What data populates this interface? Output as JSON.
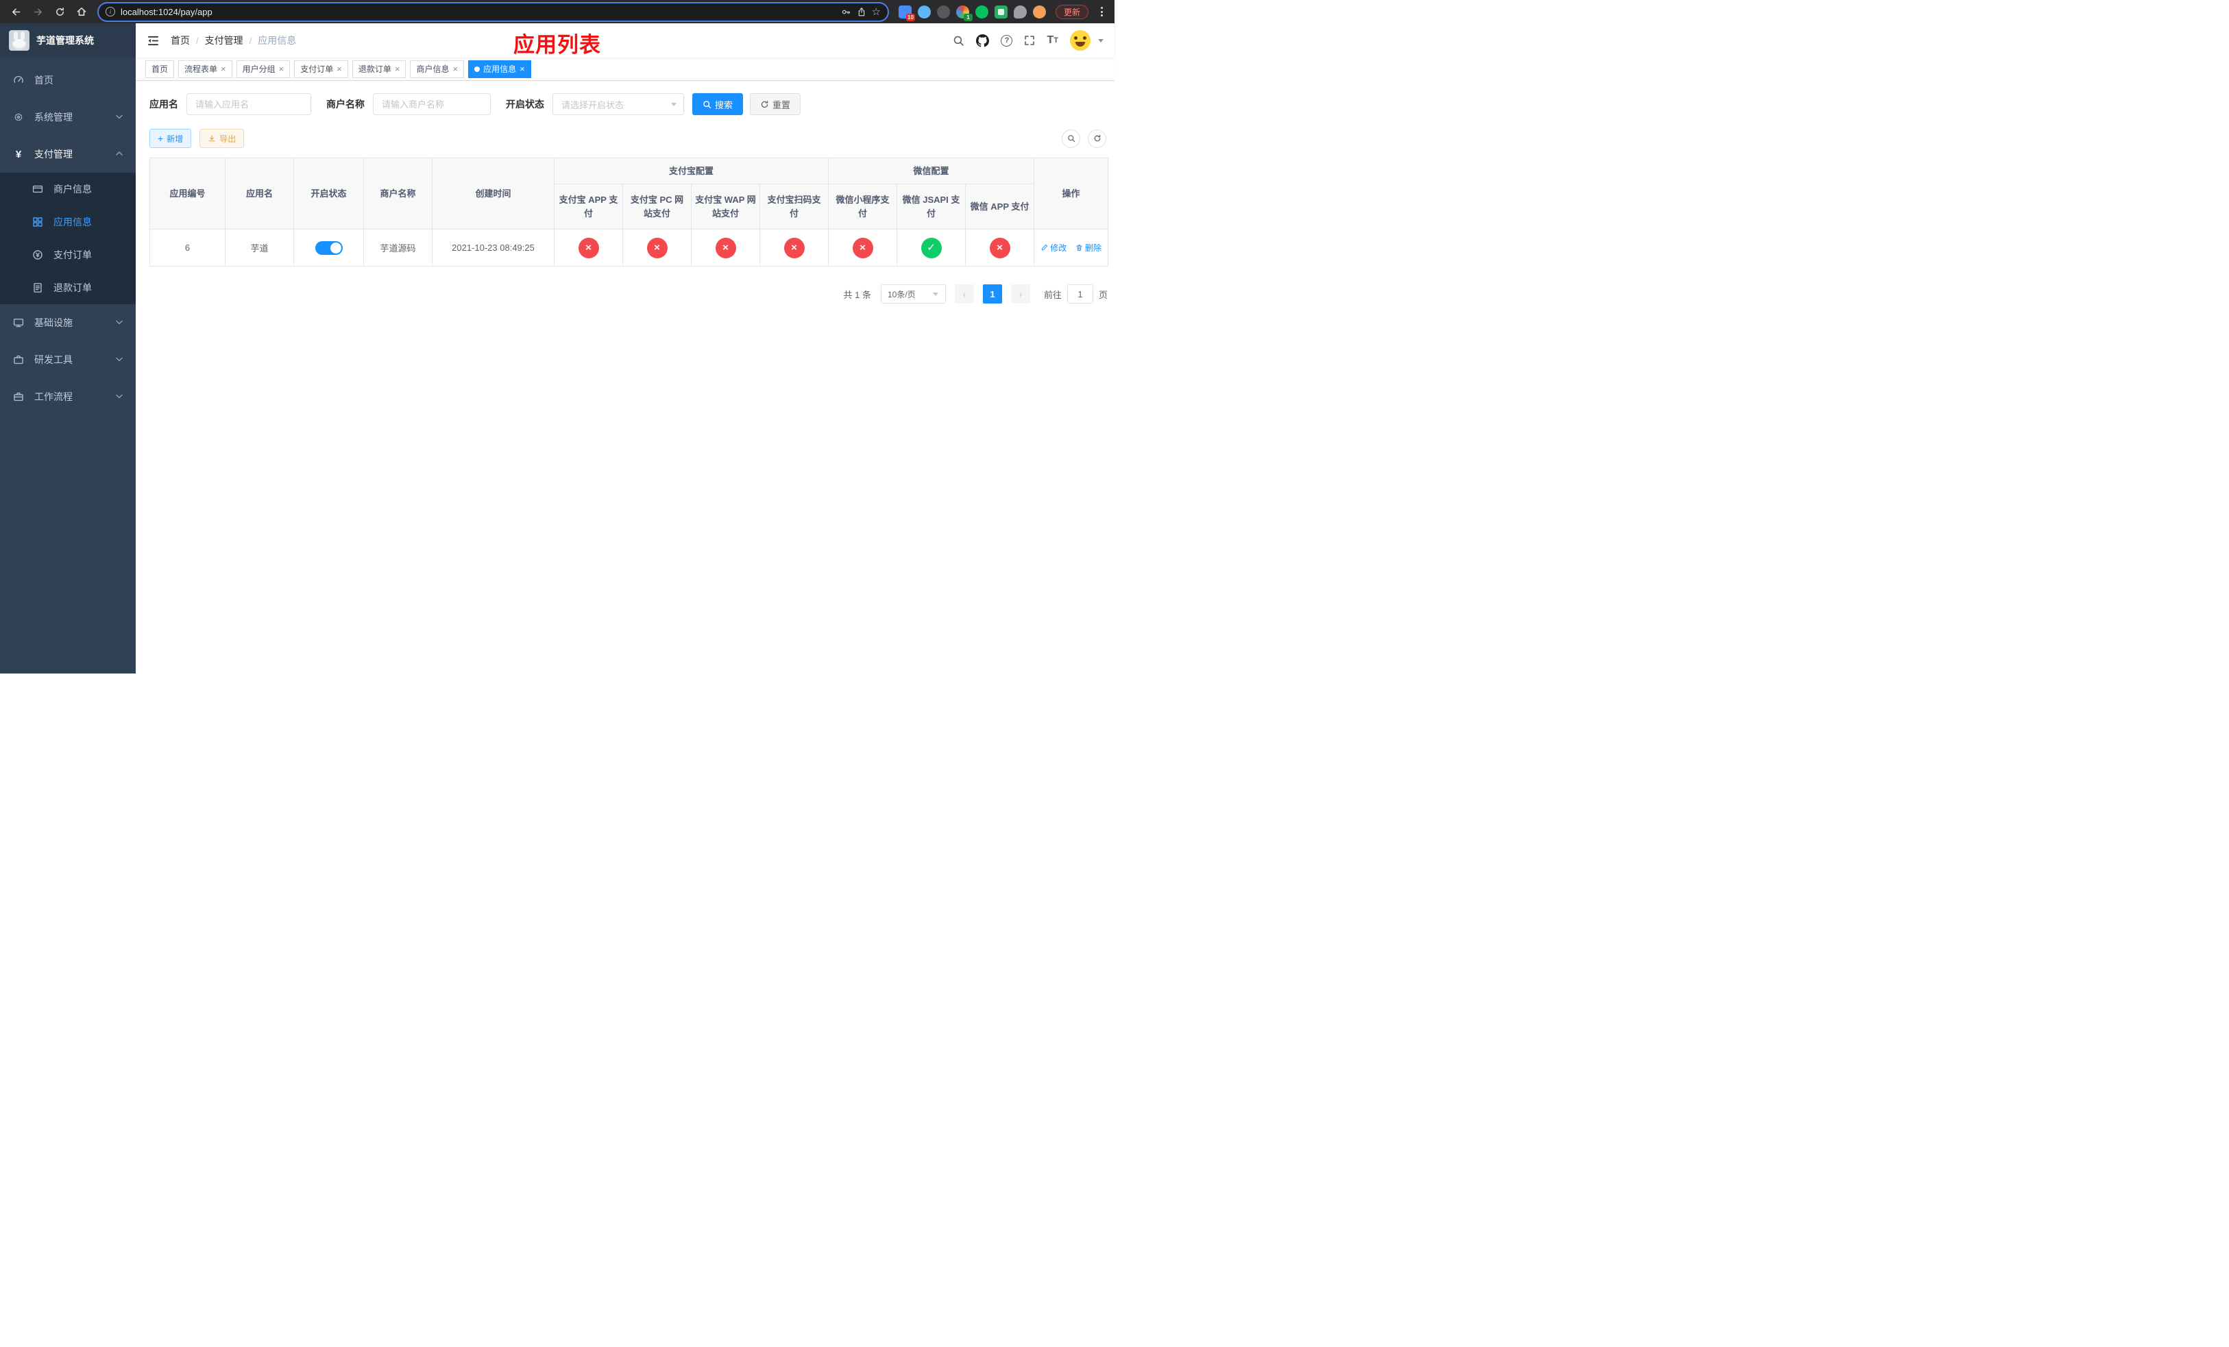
{
  "colors": {
    "accent": "#1890ff",
    "sidebar_bg": "#304156",
    "danger": "#f3494d",
    "success": "#0fce67",
    "title_red": "#f50f0f",
    "active_menu": "#409eff"
  },
  "icons": {
    "close": "×",
    "plus": "+",
    "info": "i",
    "question": "?",
    "text_large": "T",
    "text_small": "T",
    "yuan": "¥",
    "breadcrumb_sep": "/",
    "prev_arrow": "‹",
    "next_arrow": "›",
    "star": "☆"
  },
  "browser": {
    "url": "localhost:1024/pay/app",
    "update_label": "更新",
    "ext_badge_blue": "10",
    "ext_badge_wheel": "1"
  },
  "sidebar": {
    "logo_title": "芋道管理系统",
    "items": [
      {
        "label": "首页"
      },
      {
        "label": "系统管理"
      },
      {
        "label": "支付管理"
      },
      {
        "label": "基础设施"
      },
      {
        "label": "研发工具"
      },
      {
        "label": "工作流程"
      }
    ],
    "payment_children": [
      {
        "label": "商户信息"
      },
      {
        "label": "应用信息"
      },
      {
        "label": "支付订单"
      },
      {
        "label": "退款订单"
      }
    ]
  },
  "navbar": {
    "breadcrumb": [
      "首页",
      "支付管理",
      "应用信息"
    ],
    "overlay_title": "应用列表"
  },
  "tabs": [
    {
      "label": "首页"
    },
    {
      "label": "流程表单"
    },
    {
      "label": "用户分组"
    },
    {
      "label": "支付订单"
    },
    {
      "label": "退款订单"
    },
    {
      "label": "商户信息"
    },
    {
      "label": "应用信息"
    }
  ],
  "filters": {
    "app_name_label": "应用名",
    "app_name_placeholder": "请输入应用名",
    "merchant_label": "商户名称",
    "merchant_placeholder": "请输入商户名称",
    "status_label": "开启状态",
    "status_placeholder": "请选择开启状态",
    "search_button": "搜索",
    "reset_button": "重置"
  },
  "toolbar": {
    "add_button": "新增",
    "export_button": "导出"
  },
  "table": {
    "col_app_id": "应用编号",
    "col_app_name": "应用名",
    "col_status": "开启状态",
    "col_merchant": "商户名称",
    "col_created": "创建时间",
    "group_alipay": "支付宝配置",
    "group_wechat": "微信配置",
    "alipay_cols": [
      "支付宝 APP 支付",
      "支付宝 PC 网站支付",
      "支付宝 WAP 网站支付",
      "支付宝扫码支付"
    ],
    "wechat_cols": [
      "微信小程序支付",
      "微信 JSAPI 支付",
      "微信 APP 支付"
    ],
    "col_action": "操作",
    "rows": [
      {
        "id": "6",
        "name": "芋道",
        "enabled": true,
        "merchant": "芋道源码",
        "created": "2021-10-23 08:49:25",
        "alipay": [
          "no",
          "no",
          "no",
          "no"
        ],
        "wechat": [
          "no",
          "yes",
          "no"
        ],
        "edit_label": "修改",
        "delete_label": "删除"
      }
    ]
  },
  "pagination": {
    "total_text": "共 1 条",
    "page_size": "10条/页",
    "current_page": "1",
    "goto_label": "前往",
    "goto_value": "1",
    "goto_unit": "页"
  }
}
